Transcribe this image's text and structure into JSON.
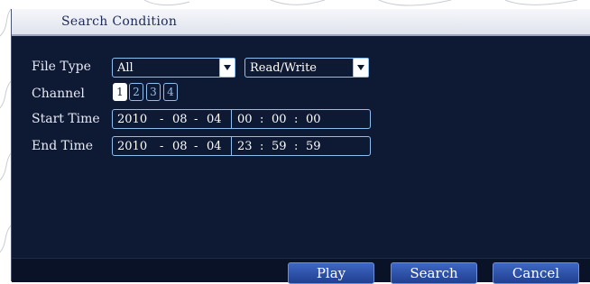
{
  "dialog": {
    "title": "Search Condition"
  },
  "file_type": {
    "label": "File Type",
    "type_value": "All",
    "mode_value": "Read/Write"
  },
  "channel": {
    "label": "Channel",
    "items": [
      "1",
      "2",
      "3",
      "4"
    ],
    "selected": "1"
  },
  "start_time": {
    "label": "Start Time",
    "year": "2010",
    "month": "08",
    "day": "04",
    "hour": "00",
    "minute": "00",
    "second": "00"
  },
  "end_time": {
    "label": "End Time",
    "year": "2010",
    "month": "08",
    "day": "04",
    "hour": "23",
    "minute": "59",
    "second": "59"
  },
  "buttons": {
    "play": "Play",
    "search": "Search",
    "cancel": "Cancel"
  },
  "colors": {
    "panel": "#0e1933",
    "accent": "#8fbff0",
    "button": "#2c4fa8"
  }
}
